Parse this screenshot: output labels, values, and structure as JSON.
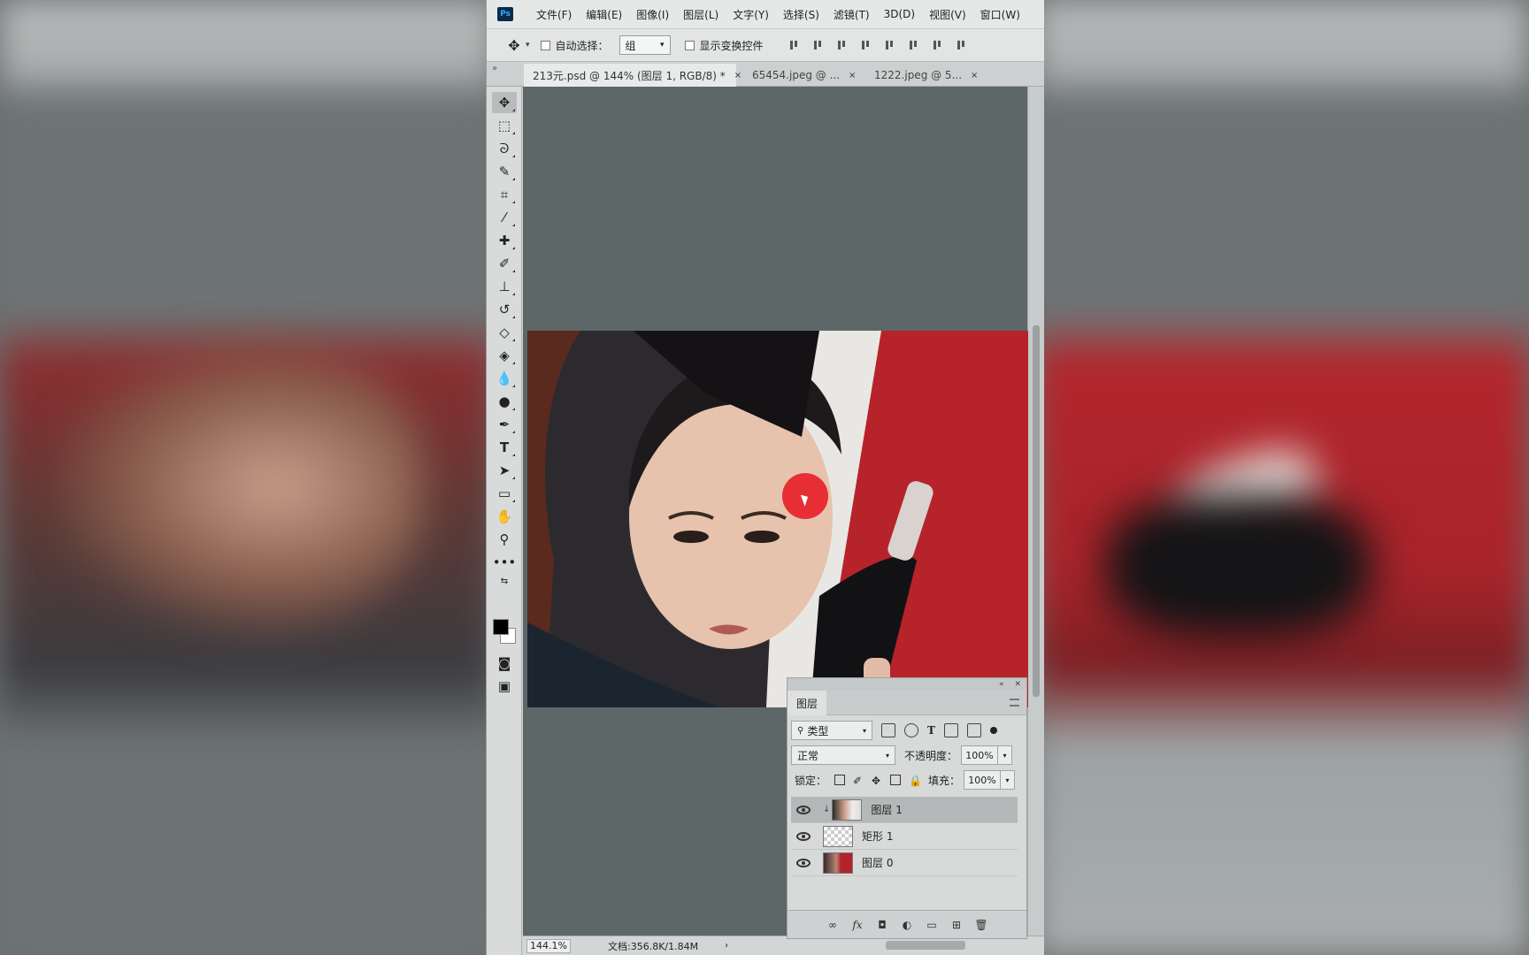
{
  "app": {
    "logo": "Ps"
  },
  "menu": [
    "文件(F)",
    "编辑(E)",
    "图像(I)",
    "图层(L)",
    "文字(Y)",
    "选择(S)",
    "滤镜(T)",
    "3D(D)",
    "视图(V)",
    "窗口(W)"
  ],
  "options": {
    "auto_select_label": "自动选择：",
    "auto_select_value": "组",
    "show_transform_label": "显示变换控件"
  },
  "tabs": [
    {
      "label": "213元.psd @ 144% (图层 1, RGB/8) *",
      "close": "×"
    },
    {
      "label": "65454.jpeg @ ...",
      "close": "×"
    },
    {
      "label": "1222.jpeg @ 5...",
      "close": "×"
    }
  ],
  "layers_panel": {
    "title": "图层",
    "filter_label": "类型",
    "blend_mode": "正常",
    "opacity_label": "不透明度：",
    "opacity_value": "100%",
    "lock_label": "锁定：",
    "fill_label": "填充：",
    "fill_value": "100%",
    "layers": [
      {
        "name": "图层 1",
        "active": true,
        "visible": true
      },
      {
        "name": "矩形 1",
        "active": false,
        "visible": true
      },
      {
        "name": "图层 0",
        "active": false,
        "visible": true
      }
    ],
    "bottom_fx": "fx"
  },
  "status": {
    "zoom": "144.1%",
    "doc_size": "文档:356.8K/1.84M",
    "arrow": "›"
  },
  "icons": [
    "move-tool-icon",
    "marquee-icon",
    "lasso-icon",
    "quick-select-icon",
    "crop-icon",
    "eyedropper-icon",
    "healing-icon",
    "brush-icon",
    "stamp-icon",
    "history-brush-icon",
    "eraser-icon",
    "paint-bucket-icon",
    "blur-icon",
    "dodge-icon",
    "pen-icon",
    "type-icon",
    "path-select-icon",
    "rectangle-icon",
    "hand-icon",
    "zoom-icon",
    "more-tools-icon"
  ],
  "colors": {
    "canvas_bg": "#5d6768",
    "image_red": "#b7232a",
    "cursor_highlight": "#e6141e"
  }
}
